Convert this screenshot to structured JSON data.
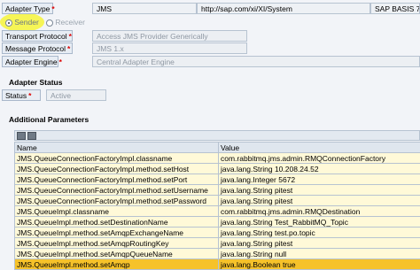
{
  "adapter": {
    "type_label": "Adapter Type",
    "type_value": "JMS",
    "type_url": "http://sap.com/xi/XI/System",
    "type_version": "SAP BASIS 7.40",
    "sender_label": "Sender",
    "receiver_label": "Receiver",
    "transport_label": "Transport Protocol",
    "transport_value": "Access JMS Provider Generically",
    "message_label": "Message Protocol",
    "message_value": "JMS 1.x",
    "engine_label": "Adapter Engine",
    "engine_value": "Central Adapter Engine"
  },
  "status_section": {
    "title": "Adapter Status",
    "status_label": "Status",
    "status_value": "Active"
  },
  "params_section": {
    "title": "Additional Parameters",
    "col_name": "Name",
    "col_value": "Value",
    "rows": [
      {
        "name": "JMS.QueueConnectionFactoryImpl.classname",
        "value": "com.rabbitmq.jms.admin.RMQConnectionFactory"
      },
      {
        "name": "JMS.QueueConnectionFactoryImpl.method.setHost",
        "value": "java.lang.String 10.208.24.52"
      },
      {
        "name": "JMS.QueueConnectionFactoryImpl.method.setPort",
        "value": "java.lang.Integer 5672"
      },
      {
        "name": "JMS.QueueConnectionFactoryImpl.method.setUsername",
        "value": "java.lang.String pitest"
      },
      {
        "name": "JMS.QueueConnectionFactoryImpl.method.setPassword",
        "value": "java.lang.String pitest"
      },
      {
        "name": "JMS.QueueImpl.classname",
        "value": "com.rabbitmq.jms.admin.RMQDestination"
      },
      {
        "name": "JMS.QueueImpl.method.setDestinationName",
        "value": "java.lang.String Test_RabbitMQ_Topic"
      },
      {
        "name": "JMS.QueueImpl.method.setAmqpExchangeName",
        "value": "java.lang.String test.po.topic"
      },
      {
        "name": "JMS.QueueImpl.method.setAmqpRoutingKey",
        "value": "java.lang.String pitest"
      },
      {
        "name": "JMS.QueueImpl.method.setAmqpQueueName",
        "value": "java.lang.String null"
      },
      {
        "name": "JMS.QueueImpl.method.setAmqp",
        "value": "java.lang.Boolean true"
      }
    ]
  },
  "colors": {
    "highlight_row": "#f6c22a",
    "marker": "#f7f43a"
  },
  "icons": [
    "add-row-icon",
    "delete-row-icon"
  ]
}
